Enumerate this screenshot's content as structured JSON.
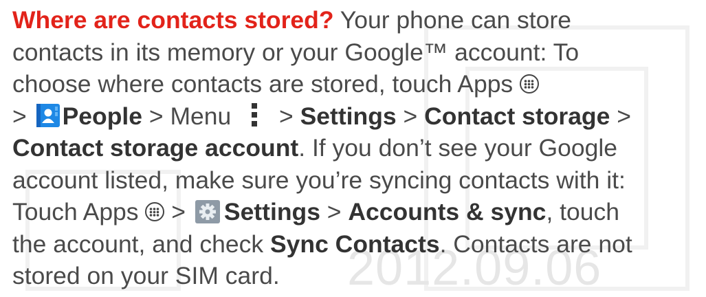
{
  "heading": "Where are contacts stored?",
  "lines": {
    "l1_rest": " Your phone can store",
    "l2": "contacts in its memory or your Google™ account: To",
    "l3_pre": "choose where contacts are stored, touch Apps ",
    "l4_gt1": "> ",
    "l4_people": "People",
    "l4_menu": " > Menu ",
    "l4_gt2": " > ",
    "l4_settings": "Settings",
    "l4_gt3": " > ",
    "l4_contact_storage": "Contact storage",
    "l4_gt4": " >",
    "l5_bold": "Contact storage account",
    "l5_rest": ". If you don’t see your Google",
    "l6": "account listed, make sure you’re syncing contacts with it:",
    "l7_pre": "Touch Apps ",
    "l7_gt1": " > ",
    "l7_settings": "Settings",
    "l7_gt2": " > ",
    "l7_accounts": "Accounts & sync",
    "l7_rest": ", touch",
    "l8_pre": "the account, and check ",
    "l8_bold": "Sync Contacts",
    "l8_rest": ". Contacts are not",
    "l9": "stored on your SIM card."
  },
  "watermark": "2012.09.06",
  "icons": {
    "apps": "apps-icon",
    "people": "people-icon",
    "menu": "menu-icon",
    "settings": "settings-icon"
  },
  "colors": {
    "heading": "#e2231a",
    "body": "#4a4a4a",
    "people_icon": "#1e88e5",
    "settings_icon": "#8e9aa6"
  }
}
